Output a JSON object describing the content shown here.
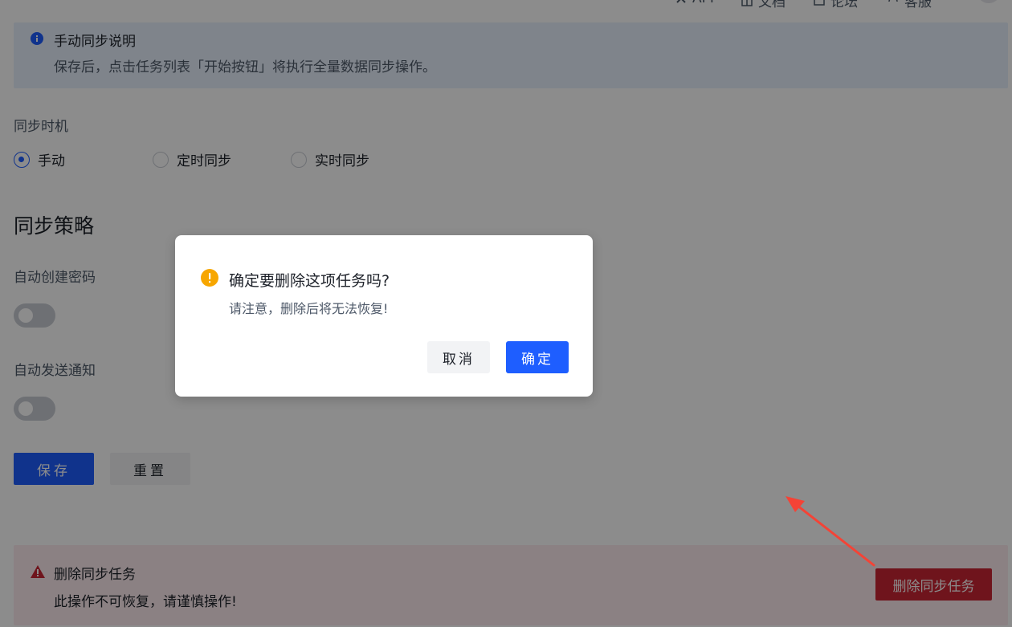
{
  "topbar": {
    "items": [
      {
        "label": "API",
        "icon": "api-icon"
      },
      {
        "label": "文档",
        "icon": "docs-icon"
      },
      {
        "label": "论坛",
        "icon": "forum-icon"
      },
      {
        "label": "客服",
        "icon": "support-icon"
      }
    ]
  },
  "info_banner": {
    "title": "手动同步说明",
    "description": "保存后，点击任务列表「开始按钮」将执行全量数据同步操作。",
    "icon": "info-icon"
  },
  "sync_timing": {
    "label": "同步时机",
    "options": [
      {
        "label": "手动",
        "checked": true
      },
      {
        "label": "定时同步",
        "checked": false
      },
      {
        "label": "实时同步",
        "checked": false
      }
    ]
  },
  "sync_strategy": {
    "heading": "同步策略",
    "auto_create_password": {
      "label": "自动创建密码",
      "enabled": false
    },
    "auto_send_notification": {
      "label": "自动发送通知",
      "enabled": false
    }
  },
  "actions": {
    "save_label": "保存",
    "reset_label": "重置"
  },
  "danger_zone": {
    "title": "删除同步任务",
    "description": "此操作不可恢复，请谨慎操作!",
    "button_label": "删除同步任务",
    "icon": "warning-triangle-icon"
  },
  "modal": {
    "title": "确定要删除这项任务吗?",
    "description": "请注意，删除后将无法恢复!",
    "cancel_label": "取消",
    "confirm_label": "确定",
    "icon": "exclamation-circle-icon"
  },
  "colors": {
    "primary": "#1e5eff",
    "danger": "#cb2634",
    "warning": "#f7a600",
    "annotation_arrow": "#f44336"
  }
}
